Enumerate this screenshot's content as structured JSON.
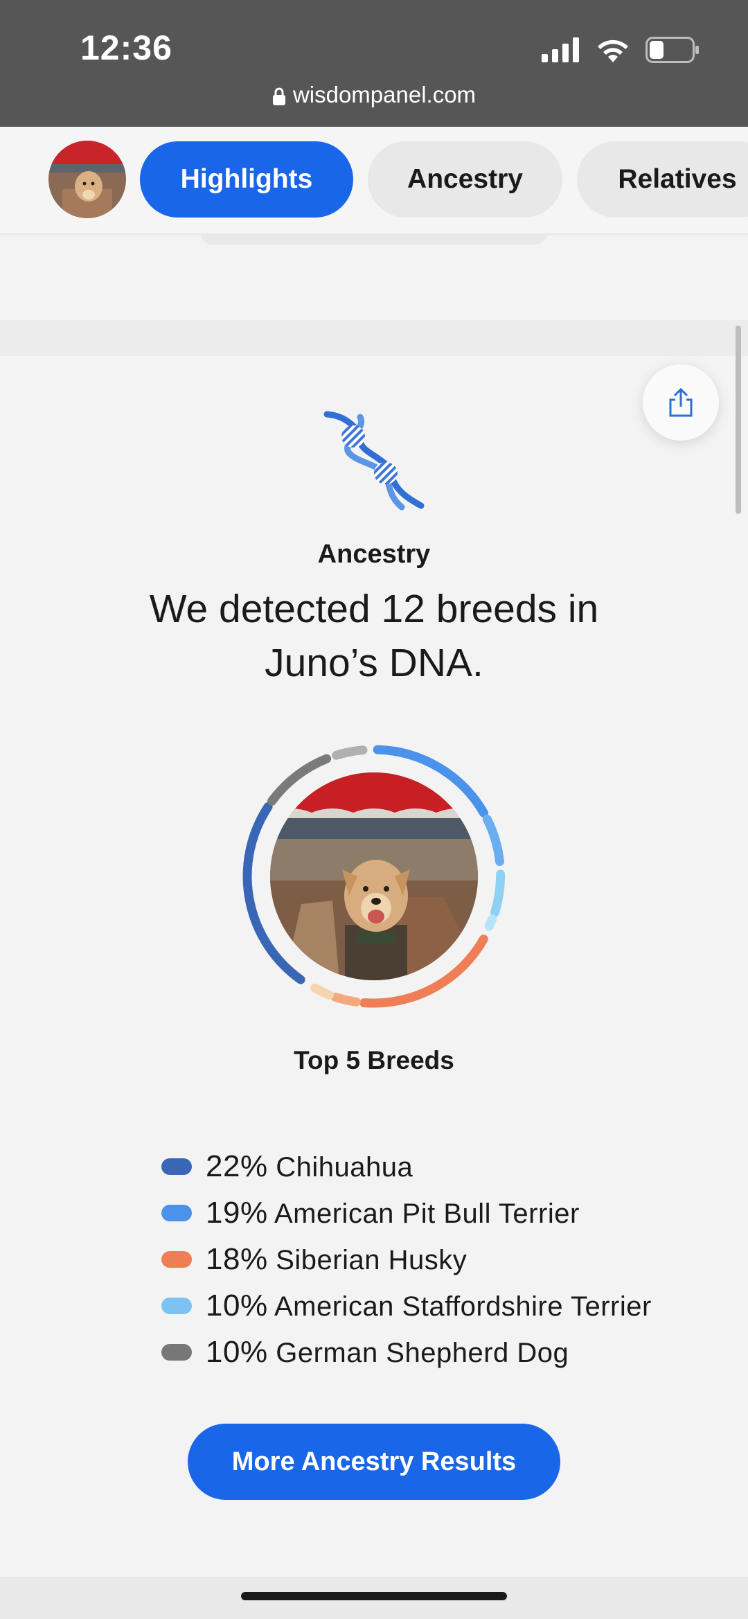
{
  "status_bar": {
    "time": "12:36",
    "url": "wisdompanel.com"
  },
  "nav": {
    "tabs": [
      {
        "label": "Highlights",
        "active": true
      },
      {
        "label": "Ancestry",
        "active": false
      },
      {
        "label": "Relatives",
        "active": false
      }
    ]
  },
  "ancestry": {
    "section_label": "Ancestry",
    "headline": "We detected 12 breeds in Juno’s DNA.",
    "top_breeds_title": "Top 5 Breeds",
    "breeds": [
      {
        "percent": "22%",
        "name": "Chihuahua",
        "value": 22,
        "color": "#3a67b5"
      },
      {
        "percent": "19%",
        "name": "American Pit Bull Terrier",
        "value": 19,
        "color": "#4a92ea"
      },
      {
        "percent": "18%",
        "name": "Siberian Husky",
        "value": 18,
        "color": "#ef7d55"
      },
      {
        "percent": "10%",
        "name": "American Staffordshire Terrier",
        "value": 10,
        "color": "#7cc3f3"
      },
      {
        "percent": "10%",
        "name": "German Shepherd Dog",
        "value": 10,
        "color": "#777777"
      }
    ],
    "cta_label": "More Ancestry Results"
  },
  "colors": {
    "accent": "#1a66e8",
    "status_bar_bg": "#565656"
  }
}
